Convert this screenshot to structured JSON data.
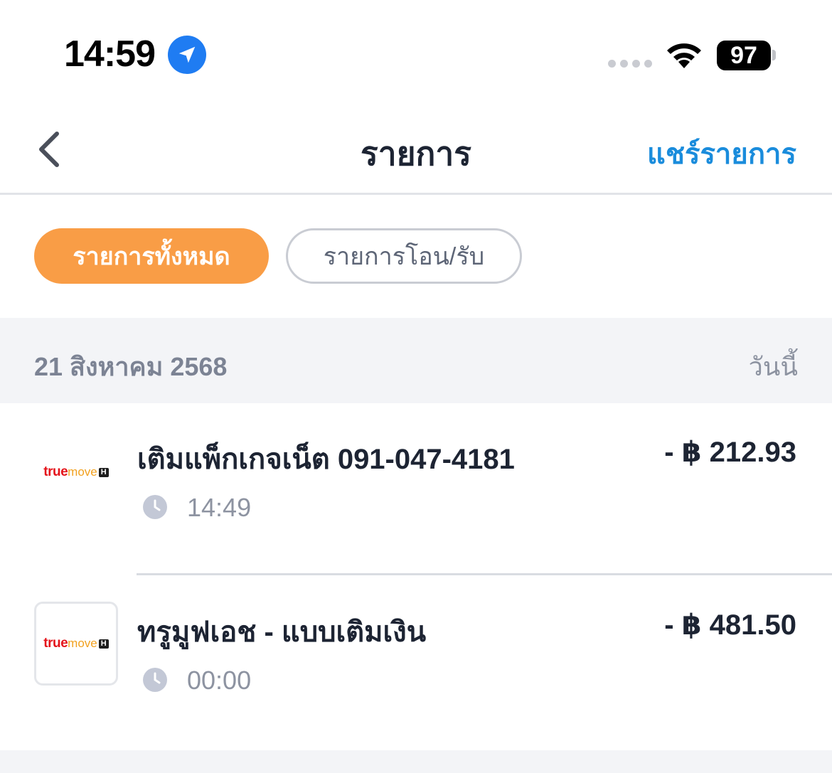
{
  "status_bar": {
    "time": "14:59",
    "battery": "97",
    "location_icon": "location-arrow-icon",
    "wifi_icon": "wifi-icon"
  },
  "nav": {
    "title": "รายการ",
    "share_label": "แชร์รายการ",
    "back_icon": "chevron-left-icon"
  },
  "filters": {
    "all_label": "รายการทั้งหมด",
    "transfer_label": "รายการโอน/รับ"
  },
  "date_group": {
    "date": "21 สิงหาคม 2568",
    "today_label": "วันนี้"
  },
  "transactions": [
    {
      "title": "เติมแพ็กเกจเน็ต 091-047-4181",
      "amount": "- ฿ 212.93",
      "time": "14:49",
      "logo_true": "true",
      "logo_move": "move",
      "logo_h": "H"
    },
    {
      "title": "ทรูมูฟเอช - แบบเติมเงิน",
      "amount": "- ฿ 481.50",
      "time": "00:00",
      "logo_true": "true",
      "logo_move": "move",
      "logo_h": "H"
    }
  ],
  "colors": {
    "accent_orange": "#f99d46",
    "link_blue": "#1a8cdc",
    "text_dark": "#1d2433",
    "text_muted": "#8d93a1"
  }
}
